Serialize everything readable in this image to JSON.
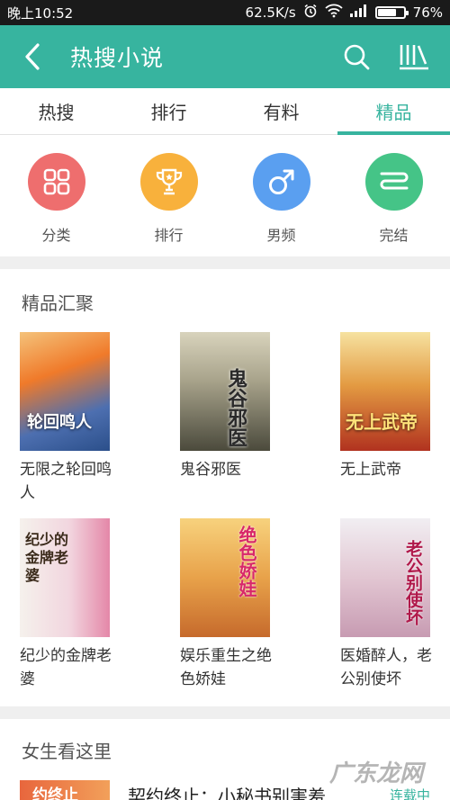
{
  "status_bar": {
    "time": "晚上10:52",
    "speed": "62.5K/s",
    "battery": "76%",
    "battery_level": 0.76
  },
  "appbar": {
    "title": "热搜小说",
    "icons": [
      "back-arrow-icon",
      "search-icon",
      "bookshelf-icon"
    ]
  },
  "tabs": [
    {
      "label": "热搜",
      "active": false
    },
    {
      "label": "排行",
      "active": false
    },
    {
      "label": "有料",
      "active": false
    },
    {
      "label": "精品",
      "active": true
    }
  ],
  "categories": [
    {
      "label": "分类",
      "icon": "grid-icon",
      "color": "#ee6e6e"
    },
    {
      "label": "排行",
      "icon": "trophy-icon",
      "color": "#f8b13c"
    },
    {
      "label": "男频",
      "icon": "male-icon",
      "color": "#5a9ff0"
    },
    {
      "label": "完结",
      "icon": "finish-icon",
      "color": "#45c487"
    }
  ],
  "featured": {
    "title": "精品汇聚",
    "books": [
      {
        "title": "无限之轮回鸣人",
        "cover_text": "轮回鸣人",
        "cover_colors": [
          "#f07a2a",
          "#2b4f8a"
        ]
      },
      {
        "title": "鬼谷邪医",
        "cover_text": "鬼谷邪医",
        "cover_colors": [
          "#c9c4a8",
          "#4b4a3c"
        ]
      },
      {
        "title": "无上武帝",
        "cover_text": "无上武帝",
        "cover_colors": [
          "#f6e2a0",
          "#b1321f"
        ]
      },
      {
        "title": "纪少的金牌老婆",
        "cover_text": "纪少的金牌老婆",
        "cover_colors": [
          "#f5f1ec",
          "#e487a8"
        ]
      },
      {
        "title": "娱乐重生之绝色娇娃",
        "cover_text": "绝色娇娃",
        "cover_colors": [
          "#f7d27d",
          "#c66a2c"
        ]
      },
      {
        "title": "医婚醉人，老公别使坏",
        "cover_text": "老公别使坏",
        "cover_colors": [
          "#f1eef2",
          "#c79bb2"
        ]
      }
    ]
  },
  "girls_section": {
    "title": "女生看这里",
    "item": {
      "title": "契约终止：小秘书别害羞",
      "cover_text": "约终止",
      "status": "连载中"
    }
  },
  "watermark": "广东龙网"
}
